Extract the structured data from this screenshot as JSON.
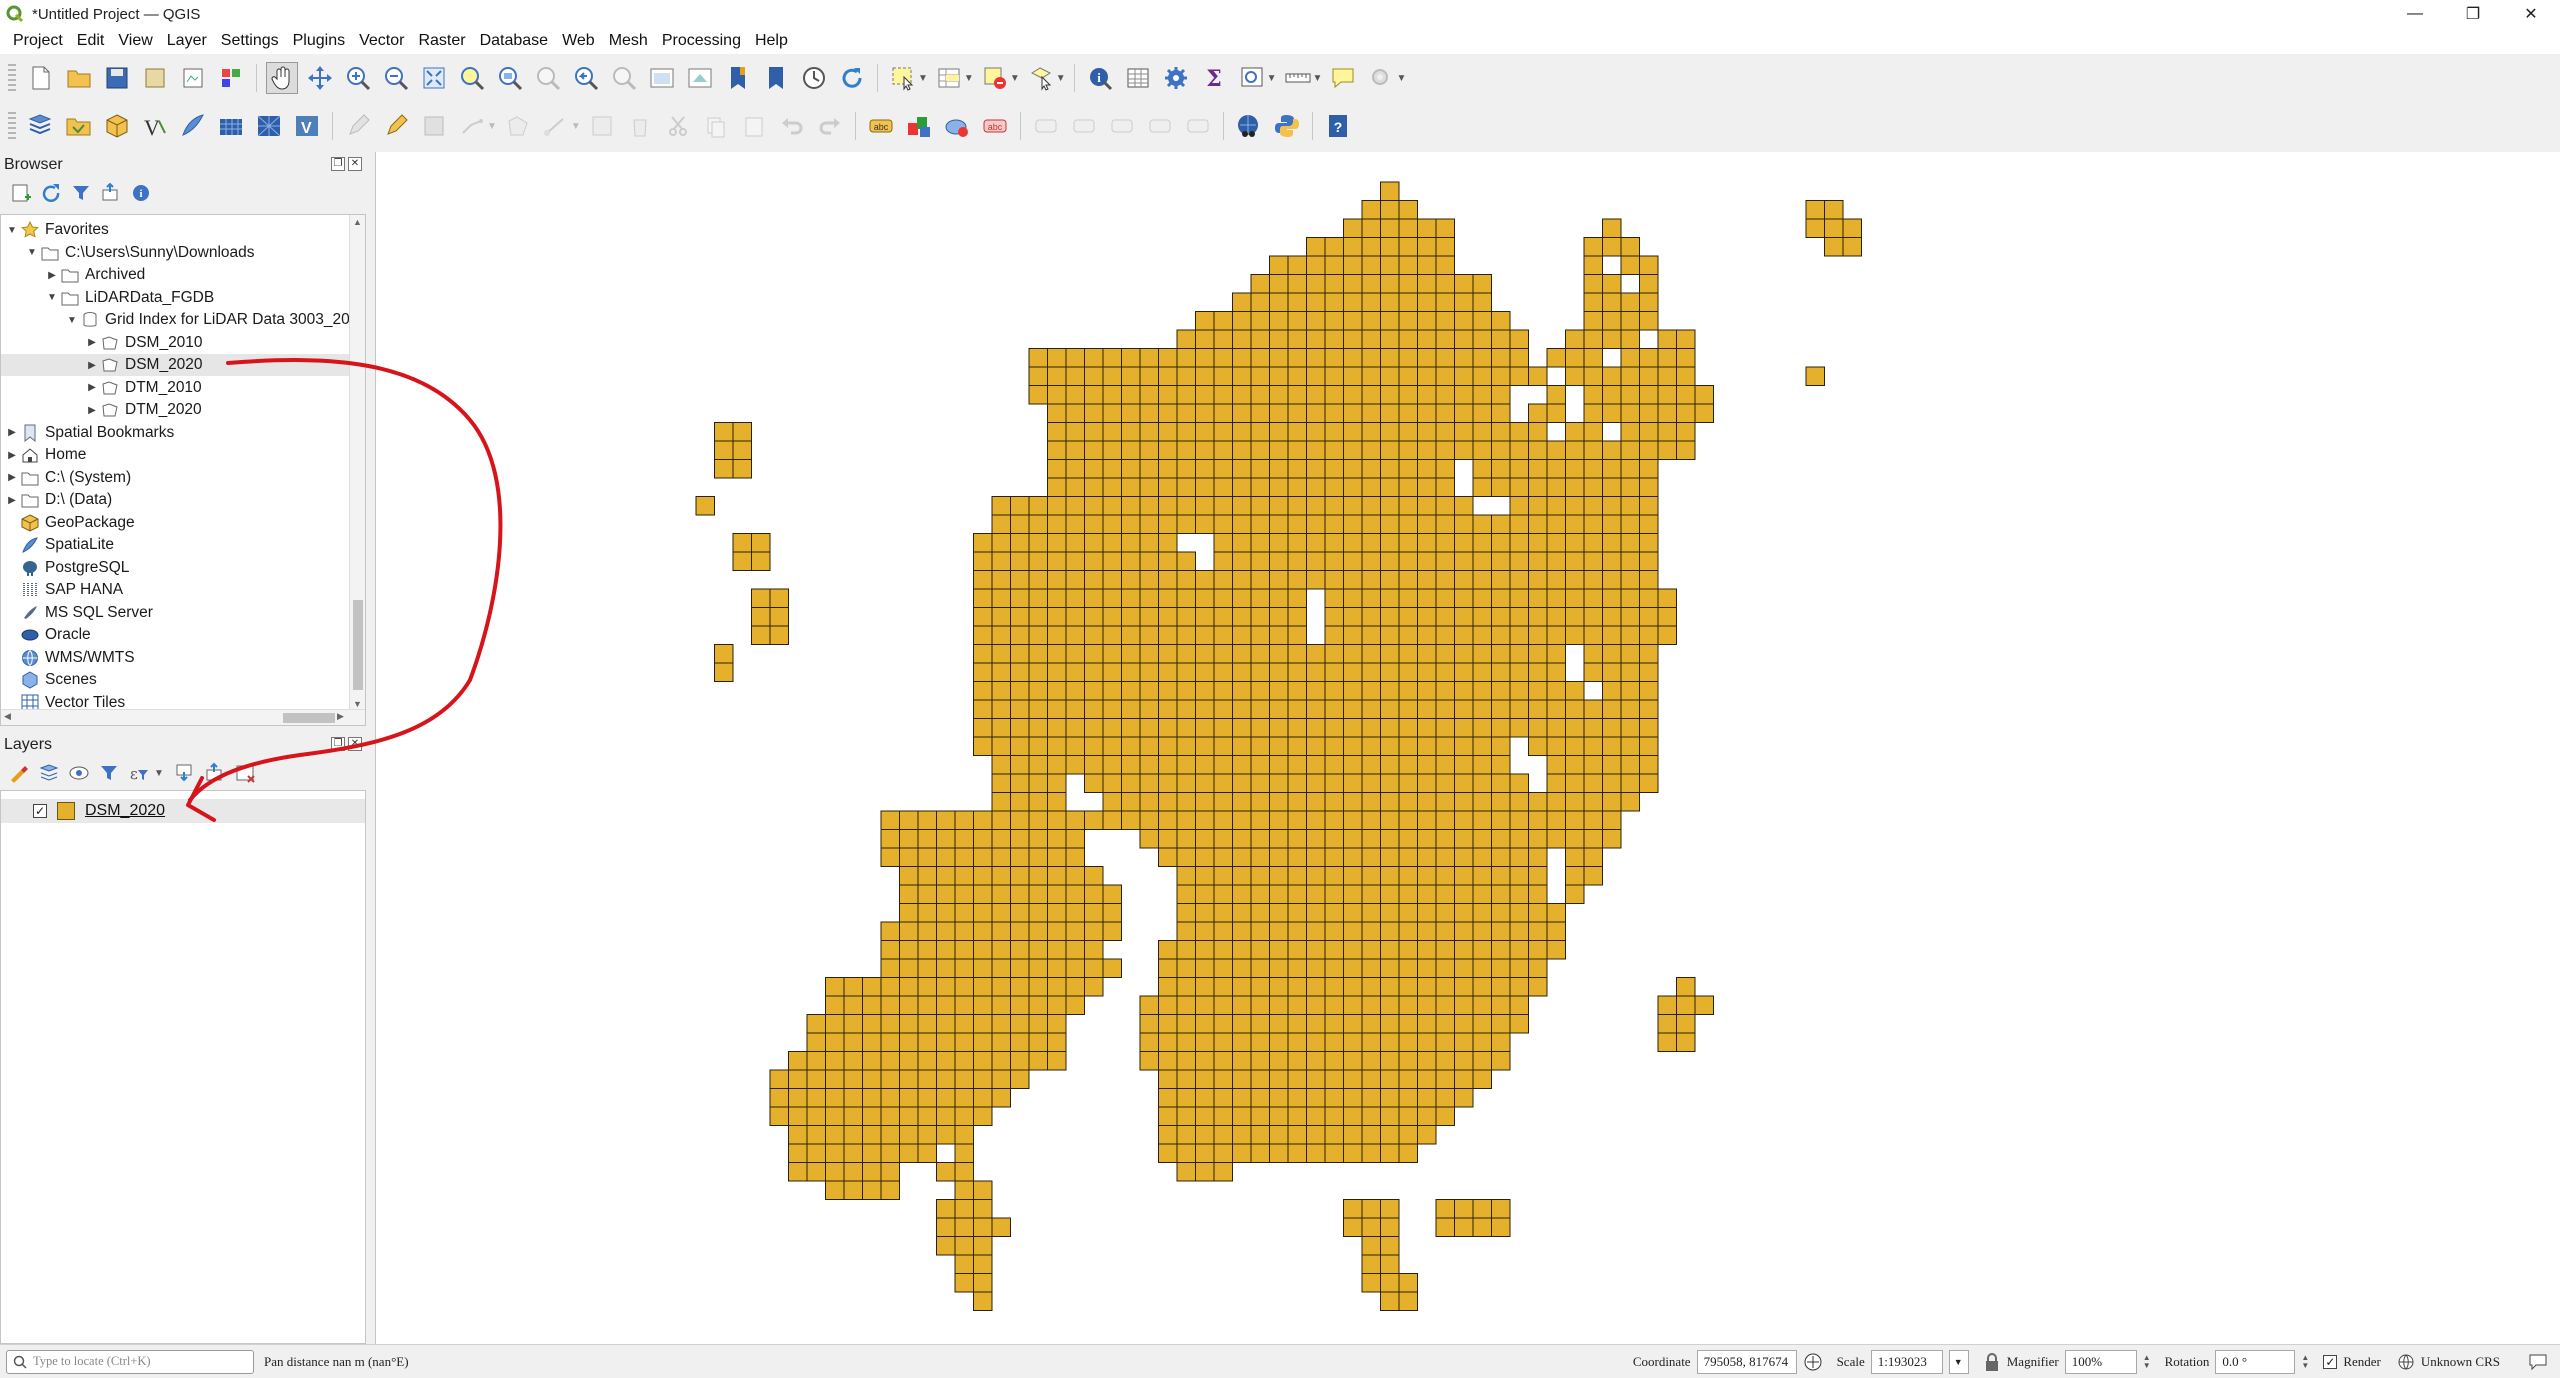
{
  "window": {
    "title": "*Untitled Project — QGIS",
    "controls": [
      "—",
      "❐",
      "✕"
    ]
  },
  "menu": [
    "Project",
    "Edit",
    "View",
    "Layer",
    "Settings",
    "Plugins",
    "Vector",
    "Raster",
    "Database",
    "Web",
    "Mesh",
    "Processing",
    "Help"
  ],
  "browser": {
    "title": "Browser",
    "items": [
      {
        "label": "Favorites",
        "indent": 0,
        "arrow": "▼",
        "icon": "star-icon"
      },
      {
        "label": "C:\\Users\\Sunny\\Downloads",
        "indent": 1,
        "arrow": "▼",
        "icon": "folder-icon"
      },
      {
        "label": "Archived",
        "indent": 2,
        "arrow": "▶",
        "icon": "folder-icon"
      },
      {
        "label": "LiDARData_FGDB",
        "indent": 2,
        "arrow": "▼",
        "icon": "folder-icon"
      },
      {
        "label": "Grid Index for LiDAR Data 3003_20",
        "indent": 3,
        "arrow": "▼",
        "icon": "database-icon"
      },
      {
        "label": "DSM_2010",
        "indent": 4,
        "arrow": "▶",
        "icon": "polygon-layer-icon"
      },
      {
        "label": "DSM_2020",
        "indent": 4,
        "arrow": "▶",
        "icon": "polygon-layer-icon",
        "selected": true
      },
      {
        "label": "DTM_2010",
        "indent": 4,
        "arrow": "▶",
        "icon": "polygon-layer-icon"
      },
      {
        "label": "DTM_2020",
        "indent": 4,
        "arrow": "▶",
        "icon": "polygon-layer-icon"
      },
      {
        "label": "Spatial Bookmarks",
        "indent": 0,
        "arrow": "▶",
        "icon": "bookmark-icon"
      },
      {
        "label": "Home",
        "indent": 0,
        "arrow": "▶",
        "icon": "home-icon"
      },
      {
        "label": "C:\\ (System)",
        "indent": 0,
        "arrow": "▶",
        "icon": "drive-icon"
      },
      {
        "label": "D:\\ (Data)",
        "indent": 0,
        "arrow": "▶",
        "icon": "drive-icon"
      },
      {
        "label": "GeoPackage",
        "indent": 0,
        "arrow": "",
        "icon": "geopackage-icon"
      },
      {
        "label": "SpatiaLite",
        "indent": 0,
        "arrow": "",
        "icon": "spatialite-icon"
      },
      {
        "label": "PostgreSQL",
        "indent": 0,
        "arrow": "",
        "icon": "postgresql-icon"
      },
      {
        "label": "SAP HANA",
        "indent": 0,
        "arrow": "",
        "icon": "saphana-icon"
      },
      {
        "label": "MS SQL Server",
        "indent": 0,
        "arrow": "",
        "icon": "mssql-icon"
      },
      {
        "label": "Oracle",
        "indent": 0,
        "arrow": "",
        "icon": "oracle-icon"
      },
      {
        "label": "WMS/WMTS",
        "indent": 0,
        "arrow": "",
        "icon": "globe-icon"
      },
      {
        "label": "Scenes",
        "indent": 0,
        "arrow": "",
        "icon": "scenes-icon"
      },
      {
        "label": "Vector Tiles",
        "indent": 0,
        "arrow": "",
        "icon": "vector-tiles-icon"
      }
    ]
  },
  "layers": {
    "title": "Layers",
    "items": [
      {
        "label": "DSM_2020",
        "checked": true,
        "fill": "#e5b02c",
        "stroke": "#3d2f0a"
      }
    ]
  },
  "map": {
    "fill": "#e5b02c",
    "stroke": "#2b2108"
  },
  "status": {
    "locator_placeholder": "Type to locate (Ctrl+K)",
    "message": "Pan distance nan m (nan°E)",
    "coordinate_label": "Coordinate",
    "coordinate_value": "795058, 817674",
    "scale_label": "Scale",
    "scale_value": "1:193023",
    "magnifier_label": "Magnifier",
    "magnifier_value": "100%",
    "rotation_label": "Rotation",
    "rotation_value": "0.0 °",
    "render_label": "Render",
    "render_checked": true,
    "crs_label": "Unknown CRS"
  },
  "annotation_color": "#d8141b"
}
